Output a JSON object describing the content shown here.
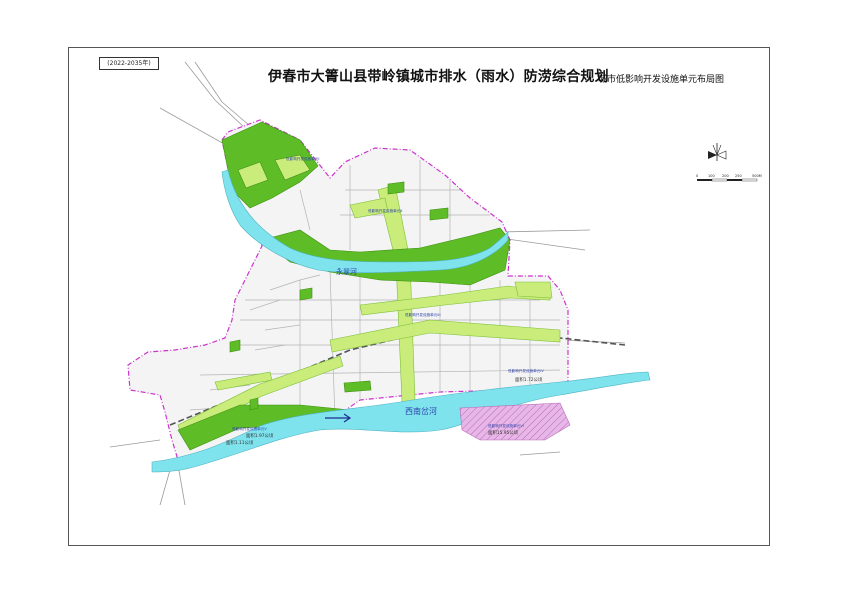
{
  "header": {
    "edition": "(2022-2035年)",
    "title": "伊春市大箐山县带岭镇城市排水（雨水）防涝综合规划",
    "subtitle": "城市低影响开发设施单元布局图"
  },
  "map": {
    "rivers": {
      "upper": "永翠河",
      "lower": "西南岔河"
    },
    "unit_labels": [
      "低影响开发设施单元I",
      "低影响开发设施单元II",
      "低影响开发设施单元III",
      "低影响开发设施单元IV",
      "低影响开发设施单元V",
      "低影响开发设施单元VI"
    ],
    "unit_areas": [
      "面积1.72公顷",
      "面积1.97公顷",
      "面积1.11公顷",
      "面积15.95公顷"
    ],
    "scale_bar": {
      "ticks": [
        "0",
        "100",
        "200",
        "250",
        "500M"
      ]
    },
    "colors": {
      "green_space": "#5ebd26",
      "corridor": "#c9ec7a",
      "river": "#7fe3ee",
      "river_text": "#2a3fa8",
      "boundary": "#cc33cc",
      "hatch_zone": "#e7b7e7",
      "roads": "#9a9a9a"
    }
  }
}
